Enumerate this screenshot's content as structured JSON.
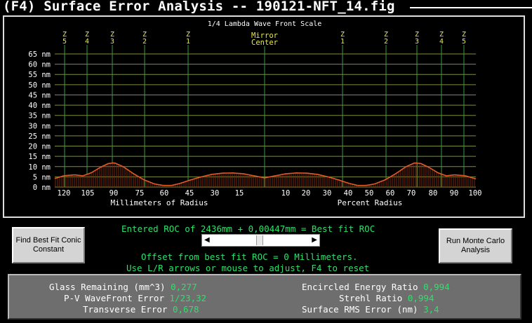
{
  "window": {
    "title": "(F4) Surface Error Analysis -- 190121-NFT_14.fig"
  },
  "plot": {
    "scale_title": "1/4 Lambda Wave Front Scale",
    "center_label_1": "Mirror",
    "center_label_2": "Center",
    "zone_prefix": "Z",
    "zones_left": [
      "5",
      "4",
      "3",
      "2",
      "1"
    ],
    "zones_right": [
      "1",
      "2",
      "3",
      "4",
      "5"
    ],
    "y_ticks": [
      "65 nm",
      "60 nm",
      "55 nm",
      "50 nm",
      "45 nm",
      "40 nm",
      "35 nm",
      "30 nm",
      "25 nm",
      "20 nm",
      "15 nm",
      "10 nm",
      "5 nm",
      "0 nm"
    ],
    "x_left_ticks": [
      "120",
      "105",
      "90",
      "75",
      "60",
      "45",
      "30",
      "15"
    ],
    "x_right_ticks": [
      "10",
      "20",
      "30",
      "40",
      "50",
      "60",
      "70",
      "80",
      "90",
      "100"
    ],
    "x_left_label": "Millimeters of Radius",
    "x_right_label": "Percent Radius",
    "profile_nm": [
      [
        0.0,
        4.0
      ],
      [
        0.05,
        5.5
      ],
      [
        0.1,
        6.0
      ],
      [
        0.14,
        5.5
      ],
      [
        0.18,
        7.0
      ],
      [
        0.22,
        9.5
      ],
      [
        0.26,
        11.5
      ],
      [
        0.29,
        11.8
      ],
      [
        0.33,
        10.0
      ],
      [
        0.38,
        6.5
      ],
      [
        0.43,
        3.5
      ],
      [
        0.48,
        1.5
      ],
      [
        0.52,
        0.8
      ],
      [
        0.56,
        0.8
      ],
      [
        0.6,
        1.8
      ],
      [
        0.65,
        3.5
      ],
      [
        0.7,
        5.0
      ],
      [
        0.75,
        6.2
      ],
      [
        0.8,
        6.8
      ],
      [
        0.85,
        6.9
      ],
      [
        0.9,
        6.5
      ],
      [
        0.95,
        5.5
      ],
      [
        1.0,
        4.5
      ]
    ],
    "colors": {
      "grid": "#7b8f3a",
      "zone_line": "#3e9a3e",
      "zone_label": "#e8e84a",
      "profile_line": "#e05a2a",
      "profile_fill": "#7a2a10",
      "axis_text": "#ffffff"
    }
  },
  "controls": {
    "best_fit_button": "Find Best Fit Conic Constant",
    "monte_carlo_button": "Run Monte Carlo Analysis",
    "roc_message": "Entered ROC of 2436mm + 0,00447mm = Best fit ROC",
    "offset_message": "Offset from best fit ROC = 0 Millimeters.",
    "hint_message": "Use L/R arrows or mouse to adjust, F4 to reset",
    "slider_left_arrow": "◀",
    "slider_right_arrow": "▶"
  },
  "stats": {
    "glass_remaining_label": "Glass Remaining (mm^3)",
    "glass_remaining_value": "0,277",
    "pv_error_label": "P-V WaveFront Error",
    "pv_error_value": "1/23,32",
    "transverse_error_label": "Transverse Error",
    "transverse_error_value": "0,678",
    "encircled_energy_label": "Encircled Energy Ratio",
    "encircled_energy_value": "0,994",
    "strehl_label": "Strehl Ratio",
    "strehl_value": "0,994",
    "rms_error_label": "Surface RMS Error (nm)",
    "rms_error_value": "3,4"
  }
}
